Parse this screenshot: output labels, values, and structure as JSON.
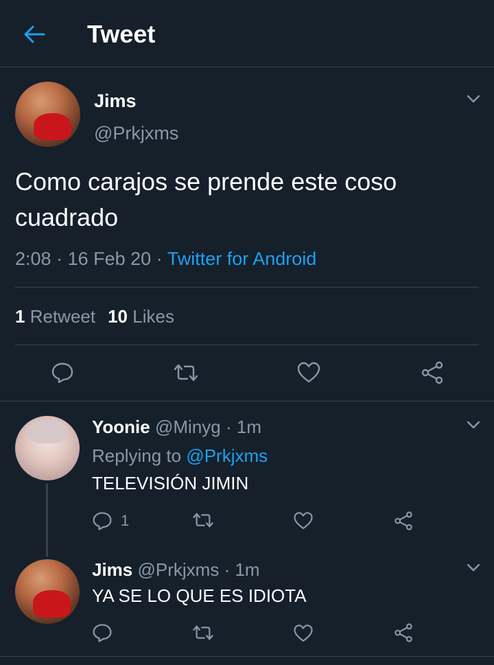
{
  "header": {
    "title": "Tweet"
  },
  "tweet": {
    "author_name": "Jims",
    "author_handle": "@Prkjxms",
    "text": "Como carajos se prende este coso cuadrado",
    "time": "2:08",
    "date": "16 Feb 20",
    "source": "Twitter for Android",
    "retweet_count": "1",
    "retweet_label": "Retweet",
    "like_count": "10",
    "like_label": "Likes"
  },
  "replies": [
    {
      "name": "Yoonie",
      "handle": "@Minyg",
      "time": "1m",
      "replying_label": "Replying to",
      "replying_to": "@Prkjxms",
      "text": "TELEVISIÓN JIMIN",
      "reply_count": "1"
    },
    {
      "name": "Jims",
      "handle": "@Prkjxms",
      "time": "1m",
      "text": "YA SE LO QUE ES IDIOTA"
    }
  ],
  "meta_separator": "·",
  "colors": {
    "background": "#15202b",
    "accent": "#1da1f2",
    "muted": "#8899a6",
    "divider": "#38444d"
  },
  "icons": [
    "back-arrow-icon",
    "chevron-down-icon",
    "reply-icon",
    "retweet-icon",
    "like-icon",
    "share-icon"
  ]
}
